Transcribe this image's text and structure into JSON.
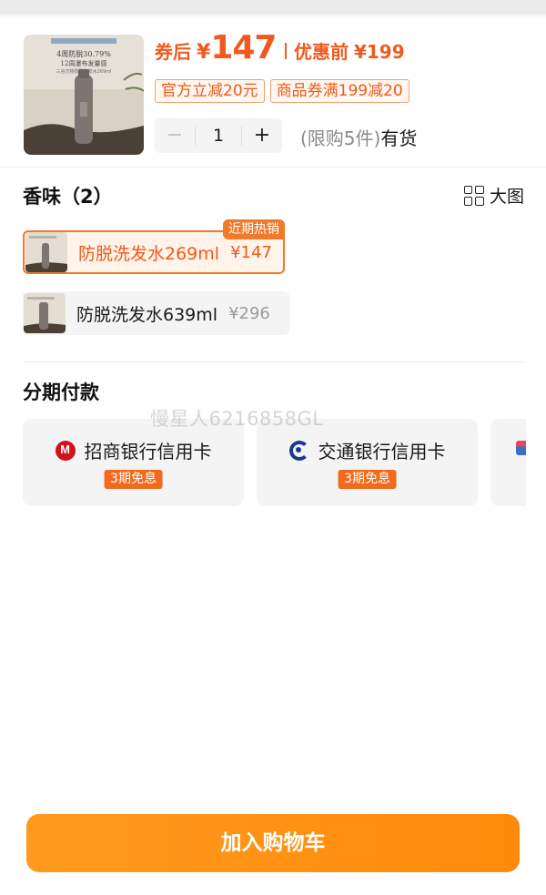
{
  "product": {
    "price_label": "券后",
    "currency": "¥",
    "price": "147",
    "original_label": "优惠前",
    "original_price": "¥199",
    "coupons": [
      "官方立减20元",
      "商品券满199减20"
    ],
    "thumbnail_text": [
      "4周防脱30.79%",
      "12周瀑布发量感",
      "三谷方物防脱洗发水269ml"
    ]
  },
  "quantity": {
    "minus": "−",
    "value": "1",
    "plus": "+",
    "limit": "(限购5件)",
    "status": "有货"
  },
  "scent": {
    "title": "香味（2）",
    "big_view_label": "大图",
    "options": [
      {
        "name": "防脱洗发水269ml",
        "price": "¥147",
        "tag": "近期热销",
        "selected": true
      },
      {
        "name": "防脱洗发水639ml",
        "price": "¥296",
        "selected": false
      }
    ]
  },
  "installment": {
    "title": "分期付款",
    "cards": [
      {
        "bank": "招商银行信用卡",
        "badge": "3期免息",
        "icon": "cmb-logo-icon"
      },
      {
        "bank": "交通银行信用卡",
        "badge": "3期免息",
        "icon": "bocom-logo-icon"
      }
    ]
  },
  "watermark": "慢星人6216858GL",
  "cart_button": "加入购物车",
  "colors": {
    "accent": "#f15a1f",
    "button": "#ff8f12",
    "badge": "#f26a1b"
  }
}
